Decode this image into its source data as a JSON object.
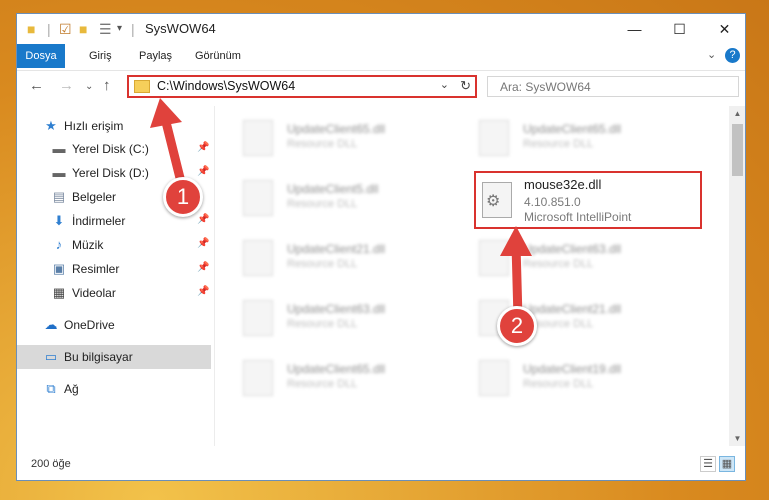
{
  "window": {
    "title": "SysWOW64",
    "controls": {
      "minimize": "—",
      "maximize": "☐",
      "close": "✕"
    }
  },
  "ribbon": {
    "tabs": [
      {
        "label": "Dosya"
      },
      {
        "label": "Giriş"
      },
      {
        "label": "Paylaş"
      },
      {
        "label": "Görünüm"
      }
    ],
    "help": "?"
  },
  "nav": {
    "address": "C:\\Windows\\SysWOW64",
    "search_placeholder": "Ara: SysWOW64"
  },
  "sidebar": {
    "quick_access": "Hızlı erişim",
    "items": [
      {
        "label": "Yerel Disk (C:)"
      },
      {
        "label": "Yerel Disk (D:)"
      },
      {
        "label": "Belgeler"
      },
      {
        "label": "İndirmeler"
      },
      {
        "label": "Müzik"
      },
      {
        "label": "Resimler"
      },
      {
        "label": "Videolar"
      }
    ],
    "onedrive": "OneDrive",
    "this_pc": "Bu bilgisayar",
    "network": "Ağ"
  },
  "files": [
    {
      "name": "UpdateClient65.dll",
      "type": "Resource DLL"
    },
    {
      "name": "UpdateClient65.dll",
      "type": "Resource DLL"
    },
    {
      "name": "UpdateClient5.dll",
      "type": "Resource DLL"
    },
    {
      "name": "UpdateClient21.dll",
      "type": "Resource DLL"
    },
    {
      "name": "UpdateClient63.dll",
      "type": "Resource DLL"
    },
    {
      "name": "UpdateClient63.dll",
      "type": "Resource DLL"
    },
    {
      "name": "UpdateClient21.dll",
      "type": "Resource DLL"
    },
    {
      "name": "UpdateClient65.dll",
      "type": "Resource DLL"
    },
    {
      "name": "UpdateClient19.dll",
      "type": "Resource DLL"
    }
  ],
  "highlighted_file": {
    "name": "mouse32e.dll",
    "version": "4.10.851.0",
    "company": "Microsoft IntelliPoint"
  },
  "status": {
    "count": "200 öğe"
  },
  "annotations": {
    "step1": "1",
    "step2": "2"
  },
  "colors": {
    "accent": "#1979ca",
    "highlight": "#d9322e",
    "arrow": "#e0423c"
  }
}
